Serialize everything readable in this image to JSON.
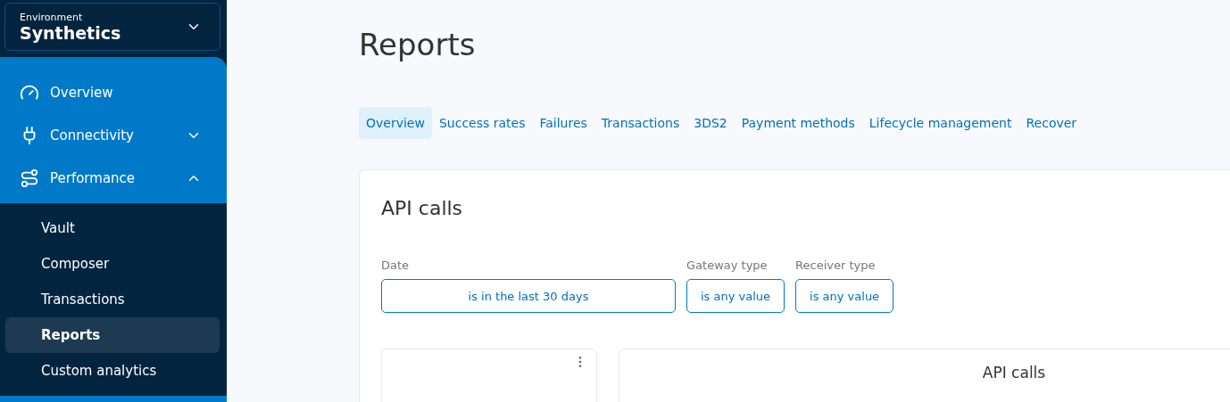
{
  "environment": {
    "label": "Environment",
    "value": "Synthetics"
  },
  "nav": [
    {
      "label": "Overview",
      "kind": "gauge"
    },
    {
      "label": "Connectivity",
      "kind": "plug",
      "expanded": false
    },
    {
      "label": "Performance",
      "kind": "route",
      "expanded": true,
      "children": [
        {
          "label": "Vault",
          "selected": false
        },
        {
          "label": "Composer",
          "selected": false
        },
        {
          "label": "Transactions",
          "selected": false
        },
        {
          "label": "Reports",
          "selected": true
        },
        {
          "label": "Custom analytics",
          "selected": false
        }
      ]
    }
  ],
  "page_title": "Reports",
  "tabs": [
    {
      "label": "Overview",
      "selected": true
    },
    {
      "label": "Success rates",
      "selected": false
    },
    {
      "label": "Failures",
      "selected": false
    },
    {
      "label": "Transactions",
      "selected": false
    },
    {
      "label": "3DS2",
      "selected": false
    },
    {
      "label": "Payment methods",
      "selected": false
    },
    {
      "label": "Lifecycle management",
      "selected": false
    },
    {
      "label": "Recover",
      "selected": false
    }
  ],
  "card": {
    "title": "API calls",
    "filters": [
      {
        "label": "Date",
        "value": "is in the last 30 days",
        "wide": true
      },
      {
        "label": "Gateway type",
        "value": "is any value",
        "wide": false
      },
      {
        "label": "Receiver type",
        "value": "is any value",
        "wide": false
      }
    ],
    "panel_title": "API calls"
  }
}
